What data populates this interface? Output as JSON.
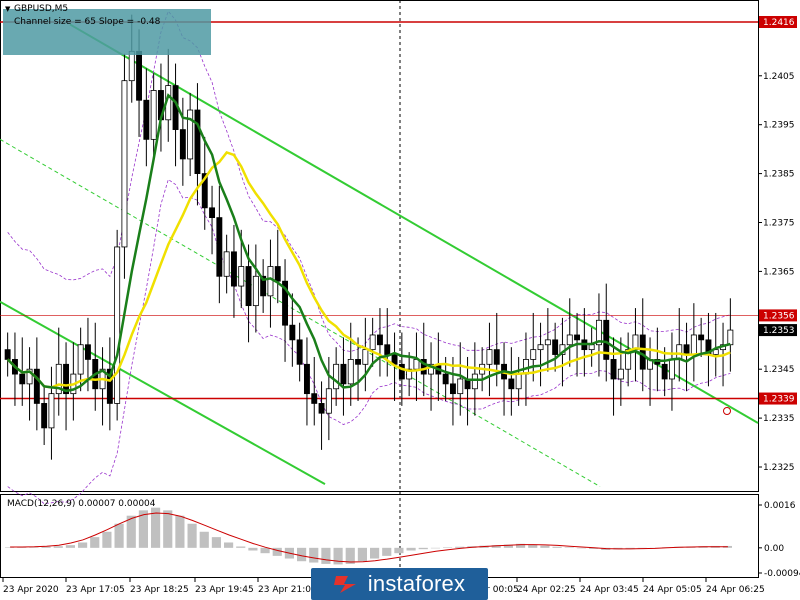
{
  "header": {
    "symbol": "GBPUSD,M5",
    "channel_info": "Channel size = 65 Slope = -0.48"
  },
  "macd": {
    "label": "MACD(12,26,9) 0.00007 0.00004"
  },
  "watermark": "instaforex",
  "colors": {
    "candles": "#000000",
    "level_lines": "#cc0000",
    "channel": "#33cc33",
    "ma_fast": "#1a7f1a",
    "ma_slow": "#f0e000",
    "bands": "#9933cc",
    "macd_hist": "#c0c0c0",
    "macd_signal": "#cc0000",
    "price_tag": "#cc0000",
    "current_tag": "#000000",
    "symbol_box": "#4f9aa3",
    "logo_bg": "#1f5f9a"
  },
  "chart_data": {
    "type": "candlestick",
    "y_ticks": [
      "1.2416",
      "1.2405",
      "1.2395",
      "1.2385",
      "1.2375",
      "1.2365",
      "1.2356",
      "1.2353",
      "1.2345",
      "1.2339",
      "1.2335",
      "1.2325"
    ],
    "highlighted_levels": [
      {
        "label": "1.2416",
        "value": 1.2416,
        "style": "red-line"
      },
      {
        "label": "1.2356",
        "value": 1.2356,
        "style": "red-tag"
      },
      {
        "label": "1.2339",
        "value": 1.2339,
        "style": "red-line"
      }
    ],
    "current_price": "1.2353",
    "x_labels": [
      "23 Apr 2020",
      "23 Apr 17:05",
      "23 Apr 18:25",
      "23 Apr 19:45",
      "23 Apr 21:05",
      "24 Apr 00:05",
      "24 Apr 02:25",
      "24 Apr 03:45",
      "24 Apr 05:05",
      "24 Apr 06:25"
    ],
    "ylim": [
      1.232,
      1.242
    ],
    "macd_ticks": [
      "0.0016",
      "0.00",
      "-0.00094"
    ],
    "macd_ylim": [
      -0.00094,
      0.0016
    ],
    "close_series": [
      1.2347,
      1.2344,
      1.2342,
      1.2345,
      1.2338,
      1.2333,
      1.234,
      1.2346,
      1.234,
      1.2344,
      1.235,
      1.2347,
      1.2341,
      1.2345,
      1.2338,
      1.237,
      1.2404,
      1.241,
      1.24,
      1.2392,
      1.2402,
      1.2396,
      1.2403,
      1.2394,
      1.2388,
      1.2398,
      1.2385,
      1.2378,
      1.2376,
      1.2364,
      1.2369,
      1.2362,
      1.2366,
      1.2358,
      1.2364,
      1.236,
      1.2366,
      1.2363,
      1.2354,
      1.2351,
      1.2346,
      1.234,
      1.2338,
      1.2336,
      1.2341,
      1.2346,
      1.2342,
      1.2347,
      1.2346,
      1.2349,
      1.2352,
      1.235,
      1.2348,
      1.2346,
      1.2343,
      1.2345,
      1.2347,
      1.2344,
      1.2346,
      1.2344,
      1.2342,
      1.234,
      1.2343,
      1.2341,
      1.2344,
      1.2346,
      1.2349,
      1.2346,
      1.2343,
      1.2341,
      1.2344,
      1.2347,
      1.2349,
      1.235,
      1.2351,
      1.2348,
      1.235,
      1.2352,
      1.2351,
      1.2349,
      1.235,
      1.2355,
      1.2347,
      1.2343,
      1.2345,
      1.2349,
      1.2352,
      1.2345,
      1.2347,
      1.2346,
      1.2343,
      1.2347,
      1.235,
      1.2348,
      1.2352,
      1.2351,
      1.2348,
      1.2349,
      1.235,
      1.2353
    ],
    "macd_hist": [
      2e-05,
      3e-05,
      2e-05,
      4e-05,
      6e-05,
      0.0001,
      0.0002,
      0.0004,
      0.0006,
      0.0009,
      0.0012,
      0.0014,
      0.0015,
      0.0014,
      0.0012,
      0.0009,
      0.0006,
      0.0004,
      0.0002,
      5e-05,
      -0.0001,
      -0.0002,
      -0.0003,
      -0.0004,
      -0.0005,
      -0.00055,
      -0.0006,
      -0.00062,
      -0.0006,
      -0.0005,
      -0.0004,
      -0.0003,
      -0.0002,
      -0.0001,
      -5e-05,
      0.0,
      2e-05,
      4e-05,
      6e-05,
      8e-05,
      0.0001,
      0.00012,
      0.00015,
      0.00012,
      8e-05,
      4e-05,
      2e-05,
      0.0,
      -4e-05,
      -8e-05,
      -6e-05,
      -4e-05,
      -2e-05,
      0.0,
      2e-05,
      4e-05,
      5e-05,
      6e-05,
      7e-05,
      7e-05
    ],
    "macd_signal": [
      3e-05,
      3e-05,
      4e-05,
      6e-05,
      0.0001,
      0.00018,
      0.0003,
      0.00048,
      0.00068,
      0.0009,
      0.0011,
      0.00124,
      0.0013,
      0.00128,
      0.00118,
      0.00102,
      0.00084,
      0.00066,
      0.00048,
      0.00032,
      0.00016,
      2e-05,
      -0.0001,
      -0.0002,
      -0.0003,
      -0.00038,
      -0.00045,
      -0.0005,
      -0.00053,
      -0.00052,
      -0.00048,
      -0.00042,
      -0.00035,
      -0.00028,
      -0.0002,
      -0.00013,
      -7e-05,
      -2e-05,
      2e-05,
      5e-05,
      8e-05,
      0.0001,
      0.00012,
      0.00012,
      0.00011,
      9e-05,
      6e-05,
      3e-05,
      0.0,
      -3e-05,
      -4e-05,
      -4e-05,
      -3e-05,
      -2e-05,
      0.0,
      2e-05,
      3e-05,
      4e-05,
      4e-05,
      4e-05
    ]
  }
}
